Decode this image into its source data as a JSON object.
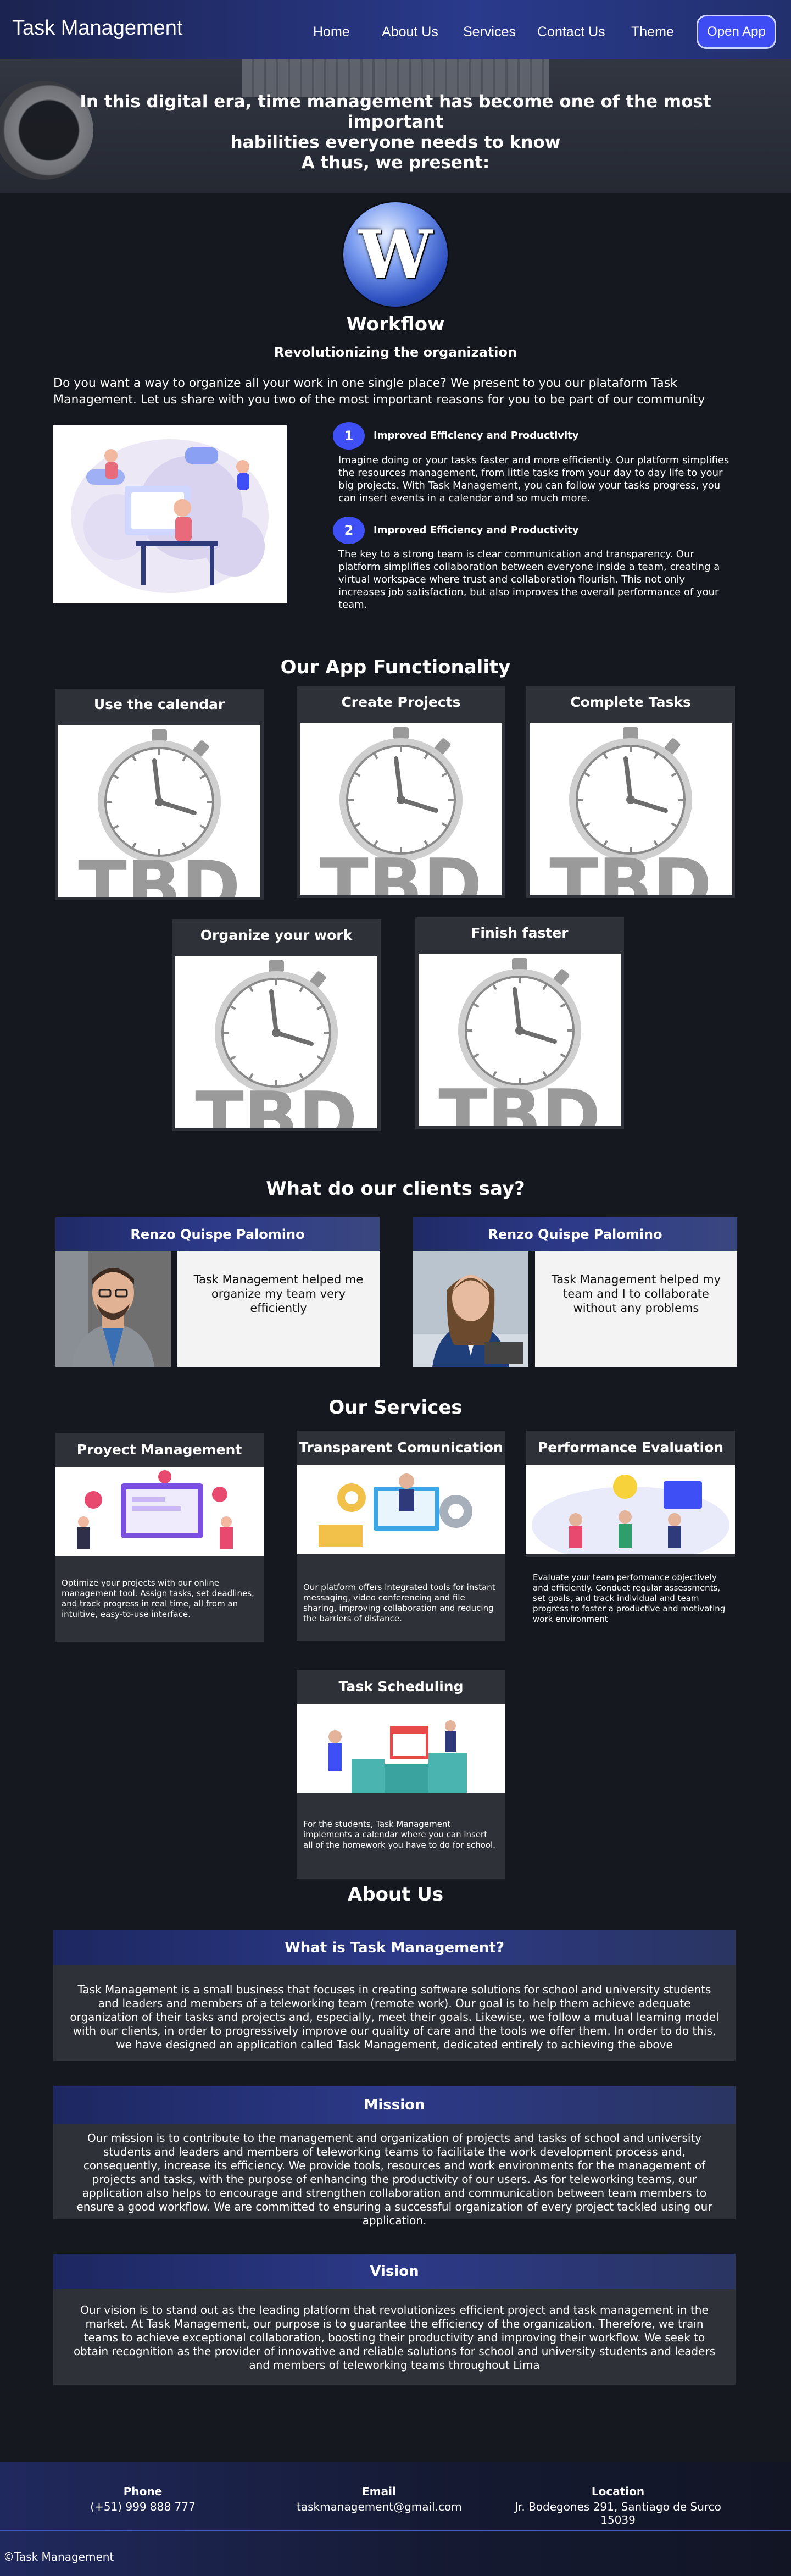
{
  "header": {
    "brand": "Task Management",
    "nav": [
      "Home",
      "About Us",
      "Services",
      "Contact Us",
      "Theme"
    ],
    "open_app": "Open App"
  },
  "hero": {
    "line1": "In this digital era, time management has become one of the most important",
    "line2": "habilities everyone needs to know",
    "line3": "A thus, we present:"
  },
  "logo_letter": "W",
  "workflow": {
    "title": "Workflow",
    "subtitle": "Revolutionizing the organization",
    "intro": "Do you want a way to organize all your work in one single place? We present to you our plataform Task Management. Let us share with you two of the most important reasons for you to be part of our community"
  },
  "reasons": [
    {
      "num": "1",
      "title": "Improved Efficiency and Productivity",
      "text": "Imagine doing or your tasks faster and more efficiently. Our platform simplifies the resources management, from little tasks from your day to day life to your big projects. With Task Management, you can follow your tasks progress, you can insert events in a calendar and so much more."
    },
    {
      "num": "2",
      "title": "Improved Efficiency and Productivity",
      "text": "The key to a strong team is clear communication and transparency. Our platform simplifies collaboration between everyone inside a team, creating a virtual workspace where trust and collaboration flourish. This not only increases job satisfaction, but also improves the overall performance of your team."
    }
  ],
  "functionality": {
    "title": "Our App Functionality",
    "cards": [
      "Use the calendar",
      "Create Projects",
      "Complete Tasks",
      "Organize your work",
      "Finish faster"
    ],
    "placeholder": "TBD"
  },
  "testimonials": {
    "title": "What do our clients say?",
    "items": [
      {
        "name": "Renzo Quispe Palomino",
        "quote": "Task Management helped me organize my team very efficiently"
      },
      {
        "name": "Renzo Quispe Palomino",
        "quote": "Task Management helped my team and I to collaborate without any problems"
      }
    ]
  },
  "services": {
    "title": "Our Services",
    "items": [
      {
        "title": "Proyect Management",
        "text": "Optimize your projects with our online management tool. Assign tasks, set deadlines, and track progress in real time, all from an intuitive, easy-to-use interface."
      },
      {
        "title": "Transparent Comunication",
        "text": "Our platform offers integrated tools for instant messaging, video conferencing and file sharing, improving collaboration and reducing the barriers of distance."
      },
      {
        "title": "Performance Evaluation",
        "text": "Evaluate your team performance objectively and efficiently. Conduct regular assessments, set goals, and track individual and team progress to foster a productive and motivating work environment"
      },
      {
        "title": "Task Scheduling",
        "text": "For the students, Task Management implements a calendar where you can insert all of the homework you have to do for school."
      }
    ]
  },
  "about": {
    "title": "About Us",
    "blocks": [
      {
        "heading": "What is Task Management?",
        "text": "Task Management is a small business that focuses in creating software solutions for school and university students and leaders and members of a teleworking team (remote work). Our goal is to help them achieve adequate organization of their tasks and projects and, especially, meet their goals. Likewise, we follow a mutual learning model with our clients, in order to progressively improve our quality of care and the tools we offer them. In order to do this, we have designed an application called Task Management, dedicated entirely to achieving the above"
      },
      {
        "heading": "Mission",
        "text": "Our mission is to contribute to the management and organization of projects and tasks of school and university students and leaders and members of teleworking teams to facilitate the work development process and, consequently, increase its efficiency. We provide tools, resources and work environments for the management of projects and tasks, with the purpose of enhancing the productivity of our users. As for teleworking teams, our application also helps to encourage and strengthen collaboration and communication between team members to ensure a good workflow. We are committed to ensuring a successful organization of every project tackled using our application."
      },
      {
        "heading": "Vision",
        "text": "Our vision is to stand out as the leading platform that revolutionizes efficient project and task management in the market. At Task Management, our purpose is to guarantee the efficiency of the organization. Therefore, we train teams to achieve exceptional collaboration, boosting their productivity and improving their workflow. We seek to obtain recognition as the provider of innovative and reliable solutions for school and university students and leaders and members of teleworking teams throughout Lima"
      }
    ]
  },
  "footer": {
    "phone_label": "Phone",
    "phone": "(+51) 999 888 777",
    "email_label": "Email",
    "email": "taskmanagement@gmail.com",
    "location_label": "Location",
    "location": "Jr. Bodegones 291, Santiago de Surco 15039",
    "copyright": "©Task Management"
  },
  "colors": {
    "accent": "#3d4ff5",
    "header": "#2a3a8c",
    "page_bg": "#15191f",
    "card_bg": "#2e3137"
  }
}
